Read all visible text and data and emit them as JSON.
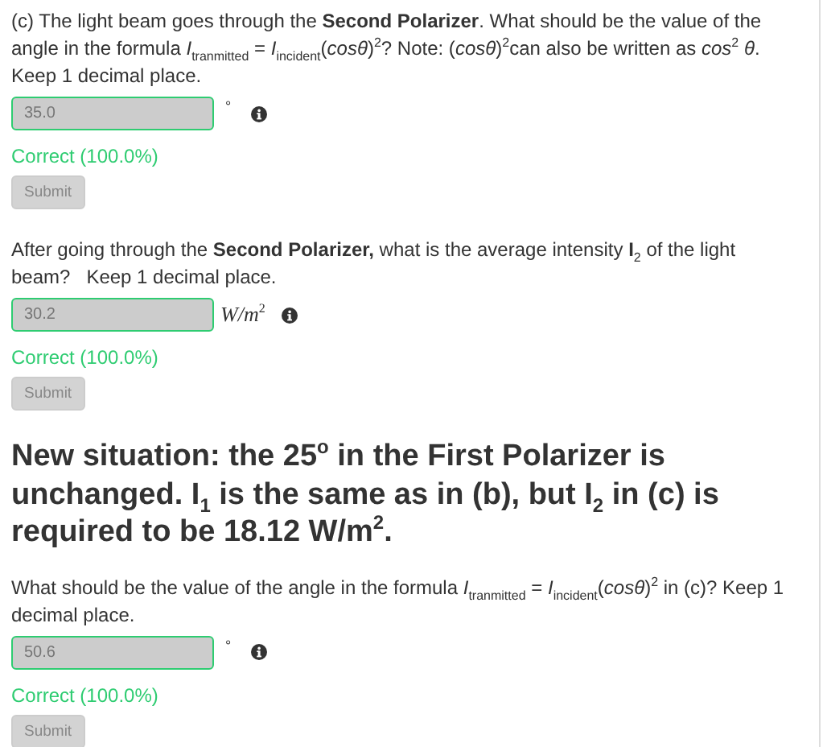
{
  "blocks": [
    {
      "kind": "question",
      "prompt": "(c) The light beam goes through the **Second Polarizer**. What should be the value of the angle in the formula *I*$_{tranmitted}$ = *I*$_{incident}$(*cosθ*)$^{2}$? Note: (*cosθ*)$^{2}$can also be written as *cos*$^{2}$ *θ*. Keep 1 decimal place.",
      "answer": "35.0",
      "unit": {
        "kind": "degree",
        "text": "°"
      },
      "correct": true,
      "feedback": "Correct (100.0%)",
      "button": "Submit",
      "disabled": true
    },
    {
      "kind": "question",
      "prompt": "After going through the **Second Polarizer,** what is the average intensity **I**$_{2}$ of the light beam?   Keep 1 decimal place.",
      "answer": "30.2",
      "unit": {
        "kind": "math",
        "text": "W/m$^{2}$"
      },
      "correct": true,
      "feedback": "Correct (100.0%)",
      "button": "Submit",
      "disabled": true
    },
    {
      "kind": "heading",
      "text": "New situation: the 25$^{o}$ in the First Polarizer is unchanged. I$_{1}$ is the same as in (b), but I$_{2}$ in (c) is required to be 18.12 W/m$^{2}$."
    },
    {
      "kind": "question",
      "prompt": "What should be the value of the angle in the formula *I*$_{tranmitted}$ = *I*$_{incident}$(*cosθ*)$^{2}$ in (c)? Keep 1 decimal place.",
      "answer": "50.6",
      "unit": {
        "kind": "degree",
        "text": "°"
      },
      "correct": true,
      "feedback": "Correct (100.0%)",
      "button": "Submit",
      "disabled": true
    }
  ]
}
